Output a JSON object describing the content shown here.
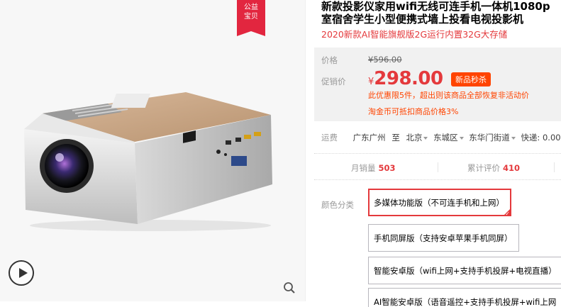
{
  "gallery": {
    "ribbon_line1": "公益",
    "ribbon_line2": "宝贝"
  },
  "product": {
    "title_line1": "新款投影仪家用wifi无线可连手机一体机1080p",
    "title_line2": "室宿舍学生小型便携式墙上投看电视投影机",
    "subtitle": "2020新款AI智能旗舰版2G运行内置32G大存储"
  },
  "price": {
    "label": "价格",
    "original": "¥596.00",
    "promo_label": "促销价",
    "currency": "¥",
    "promo_value": "298.00",
    "promo_badge": "新品秒杀",
    "promo_note": "此优惠限5件，超出则该商品全部恢复非活动价",
    "coin_note": "淘金币可抵扣商品价格3%"
  },
  "shipping": {
    "label": "运费",
    "from": "广东广州",
    "to_word": "至",
    "to_city": "北京",
    "to_district": "东城区",
    "to_street": "东华门街道",
    "delivery": "快递: 0.00"
  },
  "stats": {
    "monthly_label": "月销量",
    "monthly_value": "503",
    "reviews_label": "累计评价",
    "reviews_value": "410"
  },
  "options": {
    "label": "颜色分类",
    "items": [
      "多媒体功能版（不可连手机和上网）",
      "手机同屏版（支持安卓苹果手机同屏）",
      "智能安卓版（wifi上网+支持手机投屏+电视直播）",
      "AI智能安卓版（语音遥控+支持手机投屏+wifi上网"
    ],
    "selected_index": 0
  },
  "icons": {
    "play": "play-icon",
    "zoom": "zoom-icon"
  },
  "colors": {
    "accent": "#e4393c",
    "promo_orange": "#ff4400",
    "ribbon": "#e2263f"
  }
}
